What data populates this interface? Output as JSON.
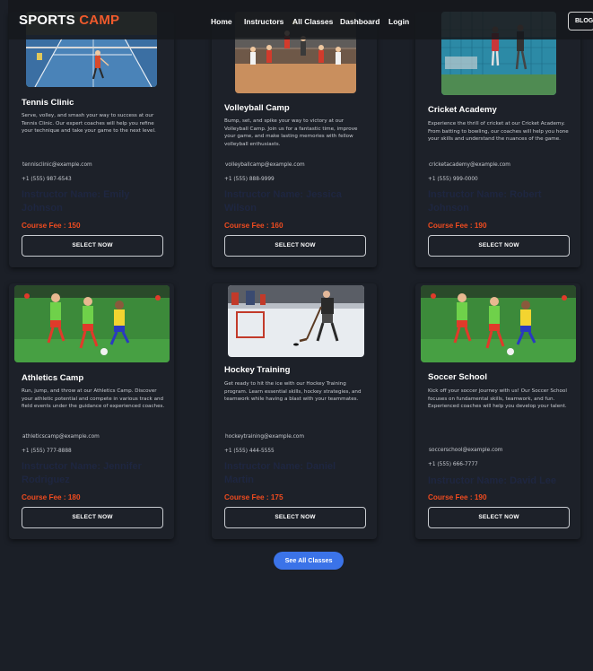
{
  "brand": {
    "part1": "SPORTS",
    "part2": "CAMP",
    "accent": "#ef5a2c"
  },
  "nav": {
    "links": [
      "Home",
      "Instructors",
      "All Classes",
      "Dashboard",
      "Login"
    ],
    "blog_label": "BLOG"
  },
  "colors": {
    "background": "#1b1f27",
    "card": "#1d2129",
    "fee": "#ef4b1f",
    "primary_button": "#3b73e8"
  },
  "cards": [
    {
      "image_icon": "tennis-court-image",
      "title": "Tennis Clinic",
      "description": "Serve, volley, and smash your way to success at our Tennis Clinic. Our expert coaches will help you refine your technique and take your game to the next level.",
      "email": "tennisclinic@example.com",
      "phone": "+1 (555) 987-6543",
      "instructor": "Instructor Name: Emily Johnson",
      "fee": "Course Fee : 150",
      "button": "SELECT NOW"
    },
    {
      "image_icon": "volleyball-court-image",
      "title": "Volleyball Camp",
      "description": "Bump, set, and spike your way to victory at our Volleyball Camp. Join us for a fantastic time, improve your game, and make lasting memories with fellow volleyball enthusiasts.",
      "email": "volleyballcamp@example.com",
      "phone": "+1 (555) 888-9999",
      "instructor": "Instructor Name: Jessica Wilson",
      "fee": "Course Fee : 160",
      "button": "SELECT NOW"
    },
    {
      "image_icon": "cricket-nets-image",
      "title": "Cricket Academy",
      "description": "Experience the thrill of cricket at our Cricket Academy. From batting to bowling, our coaches will help you hone your skills and understand the nuances of the game.",
      "email": "cricketacademy@example.com",
      "phone": "+1 (555) 999-0000",
      "instructor": "Instructor Name: Robert Johnson",
      "fee": "Course Fee : 190",
      "button": "SELECT NOW"
    },
    {
      "image_icon": "kids-soccer-image",
      "title": "Athletics Camp",
      "description": "Run, jump, and throw at our Athletics Camp. Discover your athletic potential and compete in various track and field events under the guidance of experienced coaches.",
      "email": "athleticscamp@example.com",
      "phone": "+1 (555) 777-8888",
      "instructor": "Instructor Name: Jennifer Rodriguez",
      "fee": "Course Fee : 180",
      "button": "SELECT NOW"
    },
    {
      "image_icon": "hockey-rink-image",
      "title": "Hockey Training",
      "description": "Get ready to hit the ice with our Hockey Training program. Learn essential skills, hockey strategies, and teamwork while having a blast with your teammates.",
      "email": "hockeytraining@example.com",
      "phone": "+1 (555) 444-5555",
      "instructor": "Instructor Name: Daniel Martin",
      "fee": "Course Fee : 175",
      "button": "SELECT NOW"
    },
    {
      "image_icon": "kids-soccer-image",
      "title": "Soccer School",
      "description": "Kick off your soccer journey with us! Our Soccer School focuses on fundamental skills, teamwork, and fun. Experienced coaches will help you develop your talent.",
      "email": "soccerschool@example.com",
      "phone": "+1 (555) 666-7777",
      "instructor": "Instructor Name: David Lee",
      "fee": "Course Fee : 190",
      "button": "SELECT NOW"
    }
  ],
  "see_all_label": "See All Classes"
}
